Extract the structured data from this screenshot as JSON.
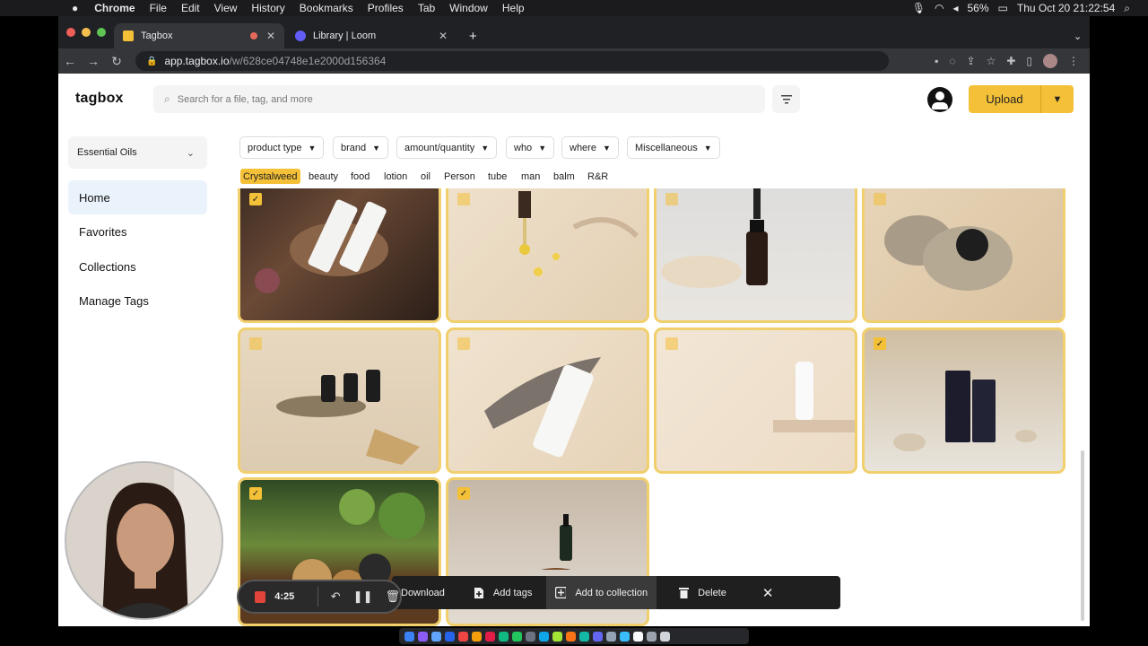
{
  "menubar": {
    "app": "Chrome",
    "items": [
      "File",
      "Edit",
      "View",
      "History",
      "Bookmarks",
      "Profiles",
      "Tab",
      "Window",
      "Help"
    ],
    "battery": "56%",
    "clock": "Thu Oct 20  21:22:54"
  },
  "browser": {
    "tabs": [
      {
        "label": "Tagbox",
        "active": true
      },
      {
        "label": "Library | Loom",
        "active": false
      }
    ],
    "url_host": "app.tagbox.io",
    "url_path": "/w/628ce04748e1e2000d156364"
  },
  "header": {
    "logo": "tagbox",
    "search_placeholder": "Search for a file, tag, and more",
    "upload_label": "Upload"
  },
  "sidebar": {
    "collection": "Essential Oils",
    "items": [
      "Home",
      "Favorites",
      "Collections",
      "Manage Tags"
    ],
    "active": "Home"
  },
  "facets": [
    "product type",
    "brand",
    "amount/quantity",
    "who",
    "where",
    "Miscellaneous"
  ],
  "tags": [
    "Crystalweed",
    "beauty",
    "food",
    "lotion",
    "oil",
    "Person",
    "tube",
    "man",
    "balm",
    "R&R"
  ],
  "selected_tag": "Crystalweed",
  "actions": {
    "download": "Download",
    "add_tags": "Add tags",
    "add_to_collection": "Add to collection",
    "delete": "Delete"
  },
  "loom": {
    "time": "4:25"
  },
  "colors": {
    "accent": "#f4c037",
    "tile_border": "#f1cf6d",
    "action_bar": "#1f1f1f"
  }
}
